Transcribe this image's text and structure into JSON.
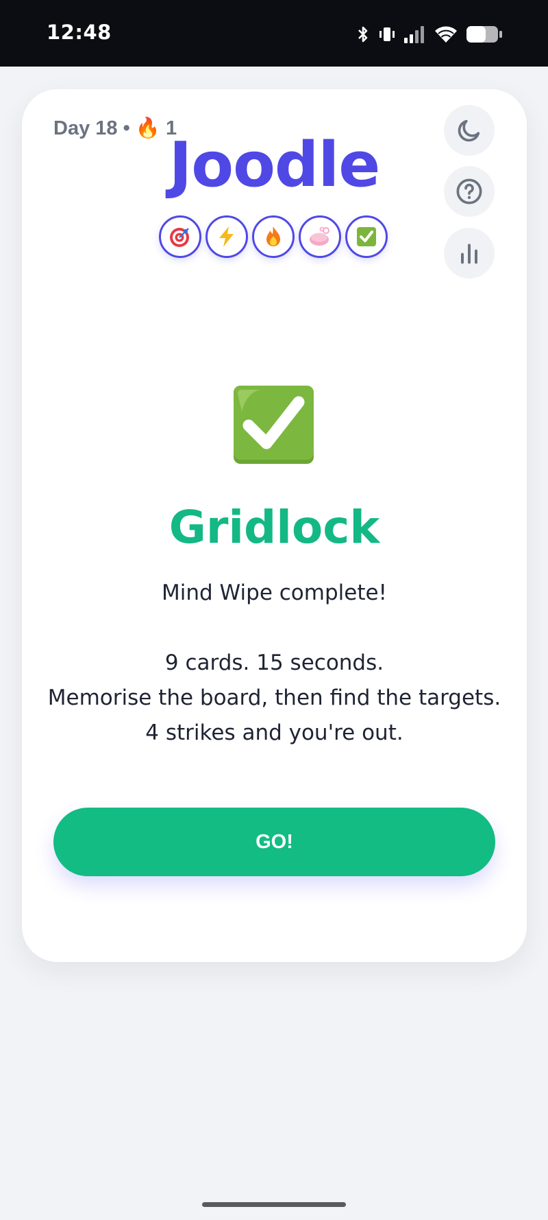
{
  "status_bar": {
    "time": "12:48",
    "icons": [
      "bluetooth-icon",
      "vibrate-icon",
      "signal-icon",
      "wifi-icon",
      "battery-icon"
    ]
  },
  "header": {
    "day_label": "Day 18 • 🔥 1",
    "logo": "Joodle",
    "badges": [
      "target-icon",
      "lightning-icon",
      "fire-icon",
      "soap-icon",
      "check-icon"
    ],
    "buttons": [
      "moon-icon",
      "help-icon",
      "stats-icon"
    ]
  },
  "game": {
    "title": "Gridlock",
    "line1": "Mind Wipe complete!",
    "line2": "9 cards. 15 seconds.",
    "line3": "Memorise the board, then find the targets.",
    "line4": "4 strikes and you're out.",
    "go_label": "GO!"
  },
  "colors": {
    "brand": "#5048e5",
    "accent_green": "#12bc83",
    "text_muted": "#6b7280"
  }
}
